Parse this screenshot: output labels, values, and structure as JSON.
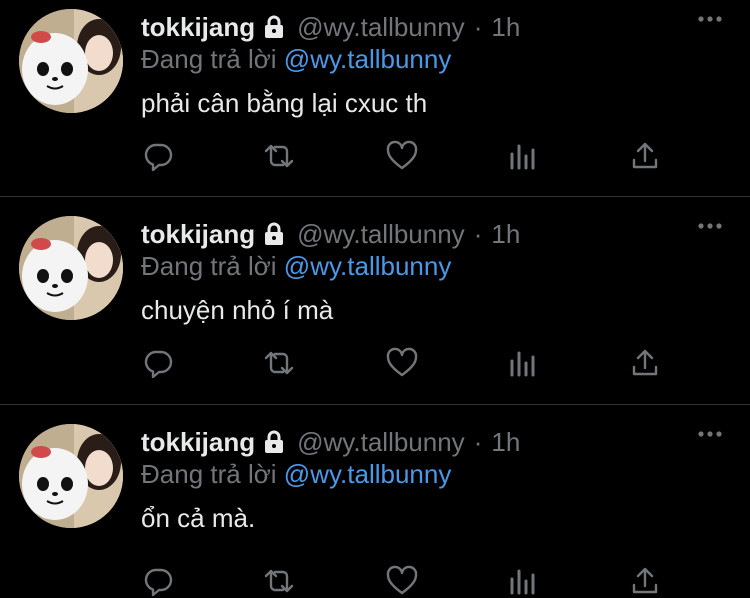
{
  "tweets": [
    {
      "name": "tokkijang",
      "handle": "@wy.tallbunny",
      "sep": "·",
      "time": "1h",
      "reply_label": "Đang trả lời",
      "reply_to": "@wy.tallbunny",
      "text": "phải cân bằng lại cxuc th"
    },
    {
      "name": "tokkijang",
      "handle": "@wy.tallbunny",
      "sep": "·",
      "time": "1h",
      "reply_label": "Đang trả lời",
      "reply_to": "@wy.tallbunny",
      "text": "chuyện nhỏ í mà"
    },
    {
      "name": "tokkijang",
      "handle": "@wy.tallbunny",
      "sep": "·",
      "time": "1h",
      "reply_label": "Đang trả lời",
      "reply_to": "@wy.tallbunny",
      "text": "ổn cả mà."
    }
  ],
  "icons": {
    "lock": "lock-icon",
    "more": "more-icon",
    "reply": "reply-icon",
    "retweet": "retweet-icon",
    "like": "like-icon",
    "views": "views-icon",
    "share": "share-icon"
  },
  "colors": {
    "background": "#000000",
    "text": "#e7e9ea",
    "muted": "#71767b",
    "link": "#4a99e9",
    "divider": "#2f3336"
  }
}
